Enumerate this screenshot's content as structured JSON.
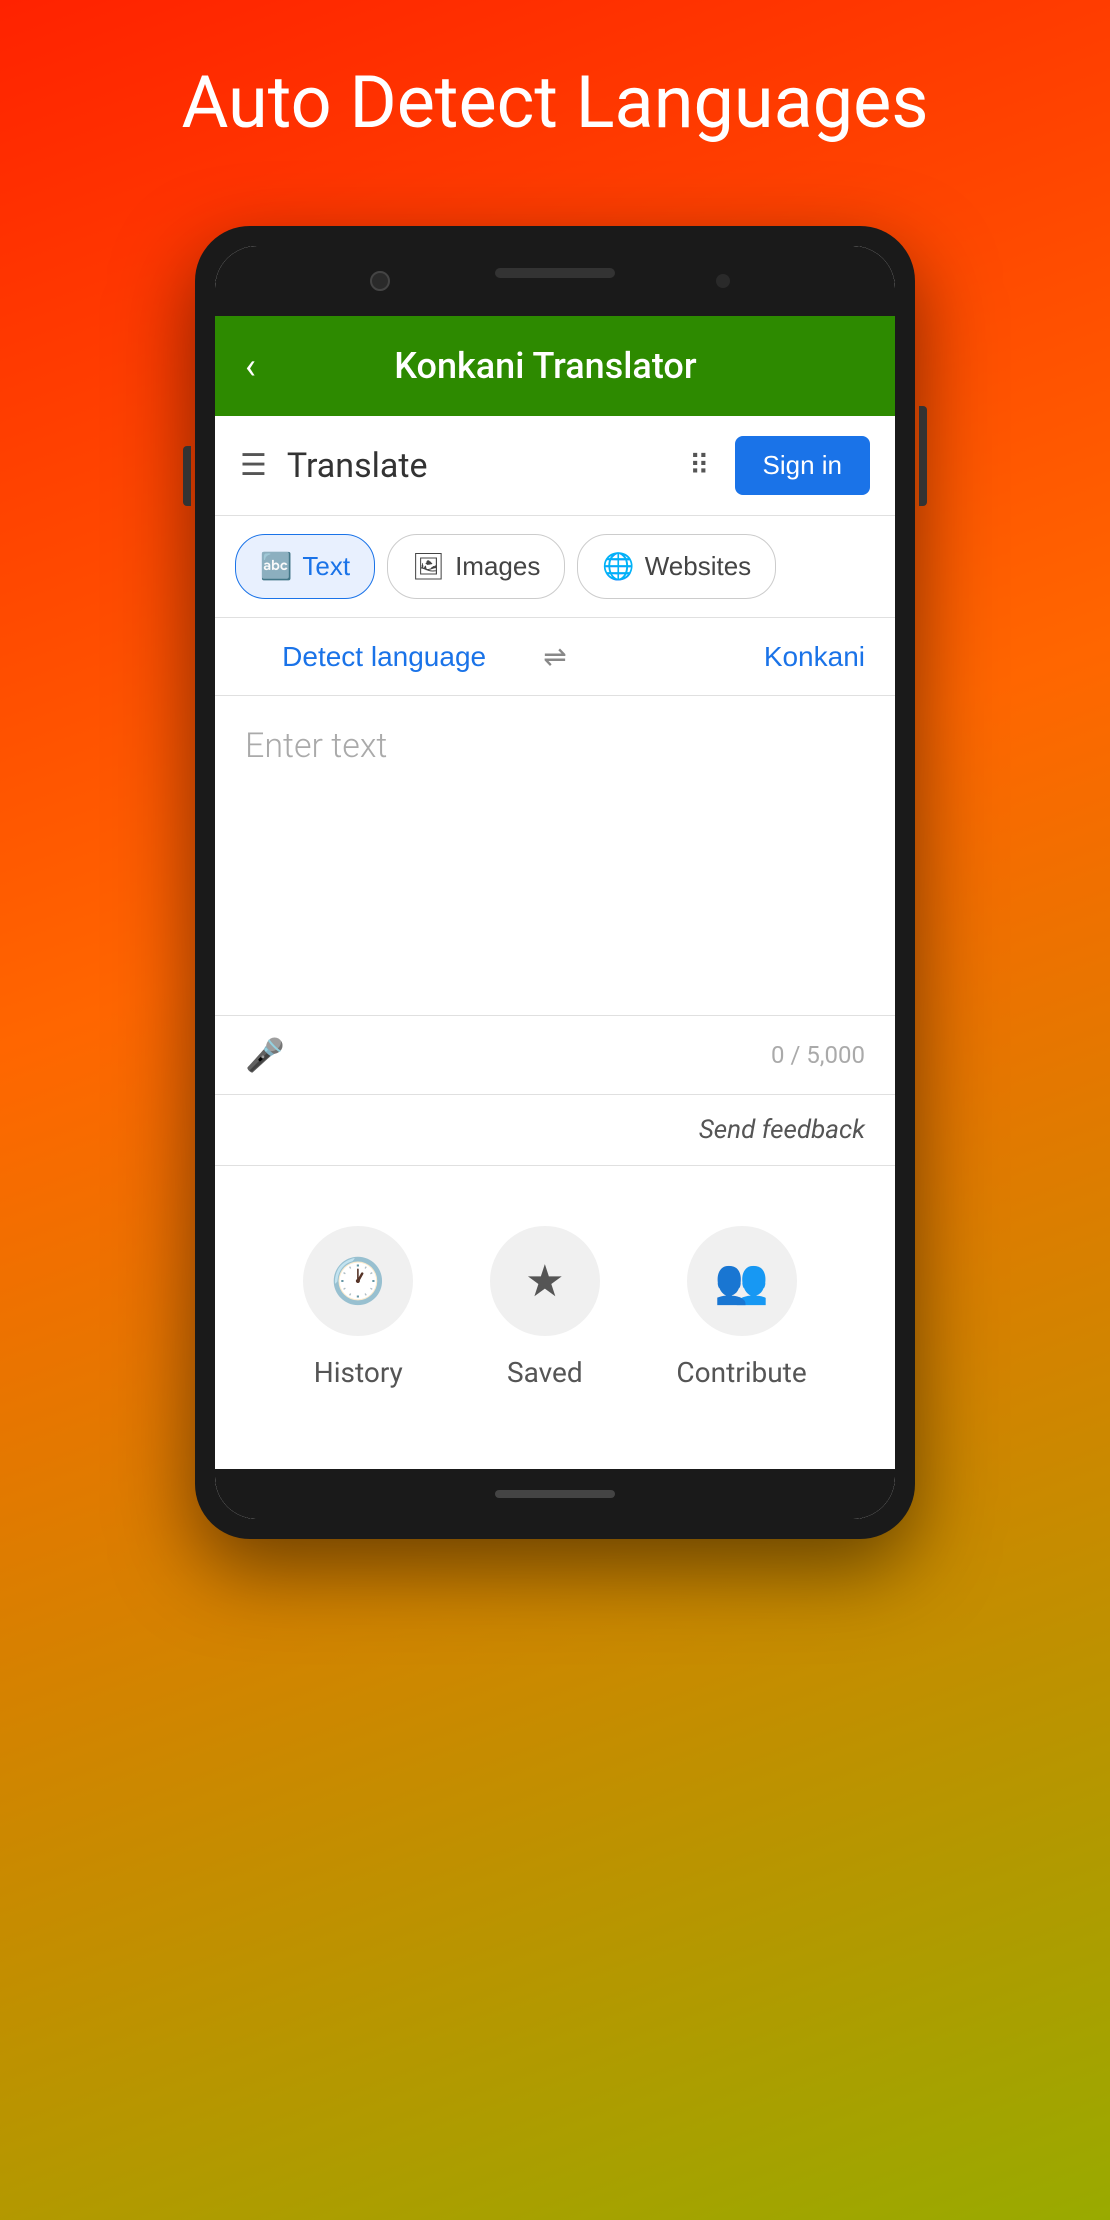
{
  "page": {
    "title": "Auto Detect Languages",
    "background_gradient": "red-to-green"
  },
  "app_bar": {
    "title": "Konkani Translator",
    "back_label": "‹"
  },
  "toolbar": {
    "title": "Translate",
    "menu_icon": "☰",
    "grid_icon": "⠿",
    "sign_in_label": "Sign in"
  },
  "tabs": [
    {
      "id": "text",
      "label": "Text",
      "icon": "🔤",
      "active": true
    },
    {
      "id": "images",
      "label": "Images",
      "icon": "🖼",
      "active": false
    },
    {
      "id": "websites",
      "label": "Websites",
      "icon": "🌐",
      "active": false
    }
  ],
  "language_bar": {
    "source_lang": "Detect language",
    "swap_icon": "⇌",
    "target_lang": "Konkani"
  },
  "input_area": {
    "placeholder": "Enter text",
    "char_count": "0 / 5,000"
  },
  "feedback": {
    "label": "Send feedback"
  },
  "bottom_actions": [
    {
      "id": "history",
      "icon": "🕐",
      "label": "History"
    },
    {
      "id": "saved",
      "icon": "★",
      "label": "Saved"
    },
    {
      "id": "contribute",
      "icon": "👥",
      "label": "Contribute"
    }
  ]
}
